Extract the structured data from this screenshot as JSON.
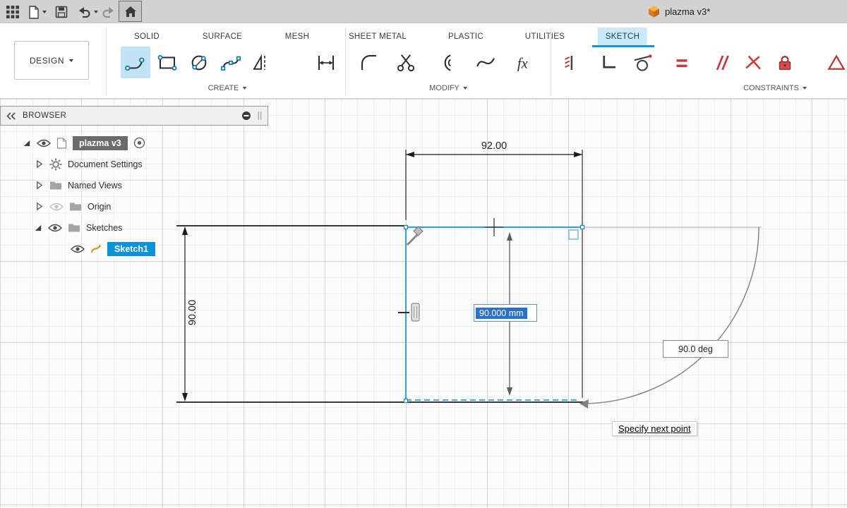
{
  "topbar": {
    "document_title": "plazma v3*"
  },
  "toolbar": {
    "design_label": "DESIGN",
    "fx_label": "fx",
    "tabs": [
      {
        "label": "SOLID",
        "active": false
      },
      {
        "label": "SURFACE",
        "active": false
      },
      {
        "label": "MESH",
        "active": false
      },
      {
        "label": "SHEET METAL",
        "active": false
      },
      {
        "label": "PLASTIC",
        "active": false
      },
      {
        "label": "UTILITIES",
        "active": false
      },
      {
        "label": "SKETCH",
        "active": true
      }
    ],
    "groups": [
      {
        "label": "CREATE"
      },
      {
        "label": "MODIFY"
      },
      {
        "label": "CONSTRAINTS"
      }
    ]
  },
  "browser": {
    "header_title": "BROWSER",
    "items": [
      {
        "label": "plazma v3",
        "state": "selected-document"
      },
      {
        "label": "Document Settings",
        "state": "collapsed"
      },
      {
        "label": "Named Views",
        "state": "collapsed"
      },
      {
        "label": "Origin",
        "state": "collapsed-hidden"
      },
      {
        "label": "Sketches",
        "state": "expanded"
      },
      {
        "label": "Sketch1",
        "state": "active-sketch"
      }
    ]
  },
  "sketch": {
    "width_dimension": "92.00",
    "height_dimension": "90.00",
    "length_input_value": "90.000 mm",
    "angle_readout": "90.0 deg",
    "prompt_tooltip": "Specify next point"
  },
  "colors": {
    "accent_blue": "#0696d7",
    "sketch_line_blue": "#2ba2dc",
    "selection_text_blue": "#2a72c8",
    "constraint_red": "#c63b3b",
    "cube_orange": "#e8832a"
  }
}
